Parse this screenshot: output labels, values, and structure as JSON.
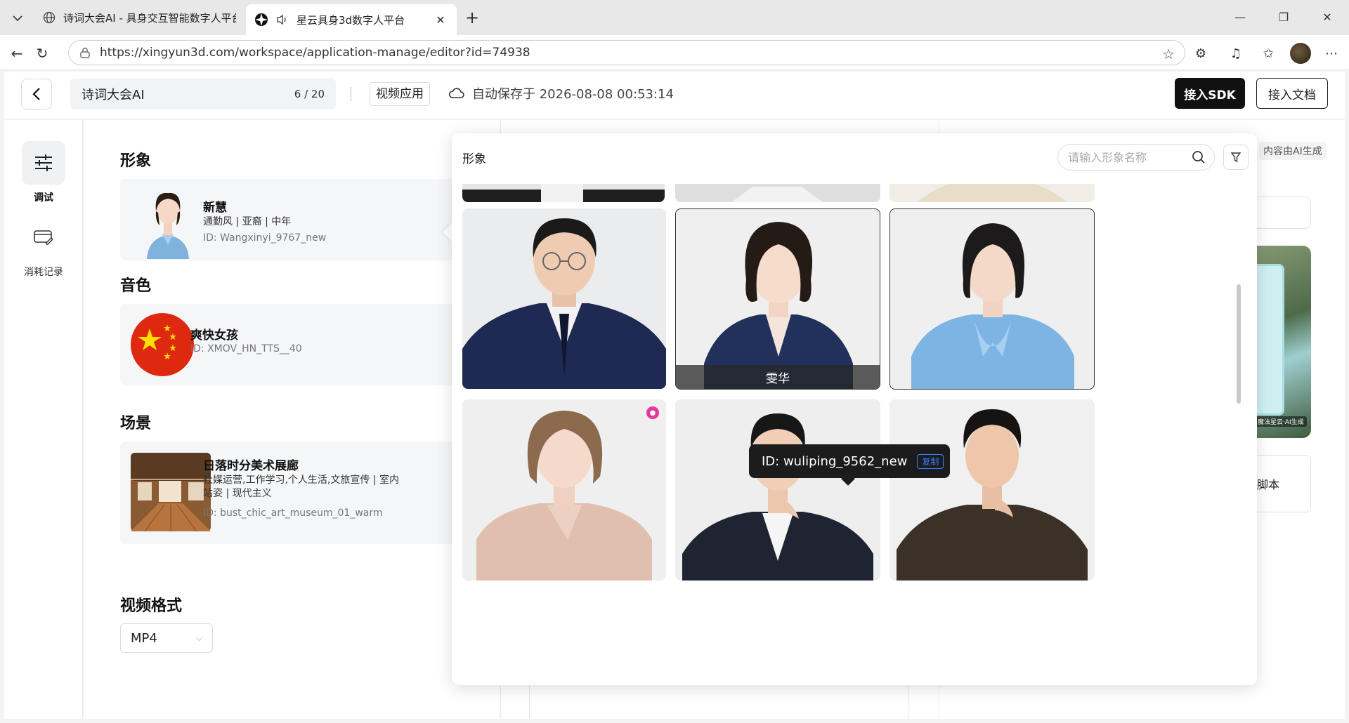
{
  "browser": {
    "tabs": [
      {
        "title": "诗词大会AI - 具身交互智能数字人平台",
        "active": false
      },
      {
        "title": "星云具身3d数字人平台",
        "active": true
      }
    ],
    "url": "https://xingyun3d.com/workspace/application-manage/editor?id=74938"
  },
  "header": {
    "app_name": "诗词大会AI",
    "name_counter": "6 / 20",
    "type_tag": "视频应用",
    "autosave_text": "自动保存于 2026-08-08 00:53:14",
    "sdk_button": "接入SDK",
    "doc_button": "接入文档"
  },
  "sidebar": {
    "items": [
      {
        "label": "调试",
        "icon": "sliders-icon",
        "active": true
      },
      {
        "label": "消耗记录",
        "icon": "card-edit-icon",
        "active": false
      }
    ]
  },
  "config": {
    "avatar_section": {
      "title": "形象",
      "name": "新慧",
      "tags": "通勤风 | 亚裔 | 中年",
      "id": "ID: Wangxinyi_9767_new"
    },
    "voice_section": {
      "title": "音色",
      "name": "爽快女孩",
      "id": "ID: XMOV_HN_TTS__40",
      "icon": "china-flag-icon"
    },
    "scene_section": {
      "title": "场景",
      "name": "日落时分美术展廊",
      "tags_line1": "社媒运营,工作学习,个人生活,文旅宣传 | 室内",
      "tags_line2": "站姿 | 现代主义",
      "id": "ID: bust_chic_art_museum_01_warm"
    },
    "format_section": {
      "title": "视频格式",
      "value": "MP4"
    }
  },
  "right_panel": {
    "ai_note": "内容由AI生成",
    "script_label": "脚本",
    "video_caption": "魔法星云·AI生成"
  },
  "picker": {
    "title": "形象",
    "search_placeholder": "请输入形象名称",
    "selected_label": "雯华",
    "tooltip_id": "ID: wuliping_9562_new",
    "tooltip_copy": "复制",
    "colors": {
      "accent_blue": "#3d7bff",
      "hot_badge": "#e2399b"
    }
  }
}
